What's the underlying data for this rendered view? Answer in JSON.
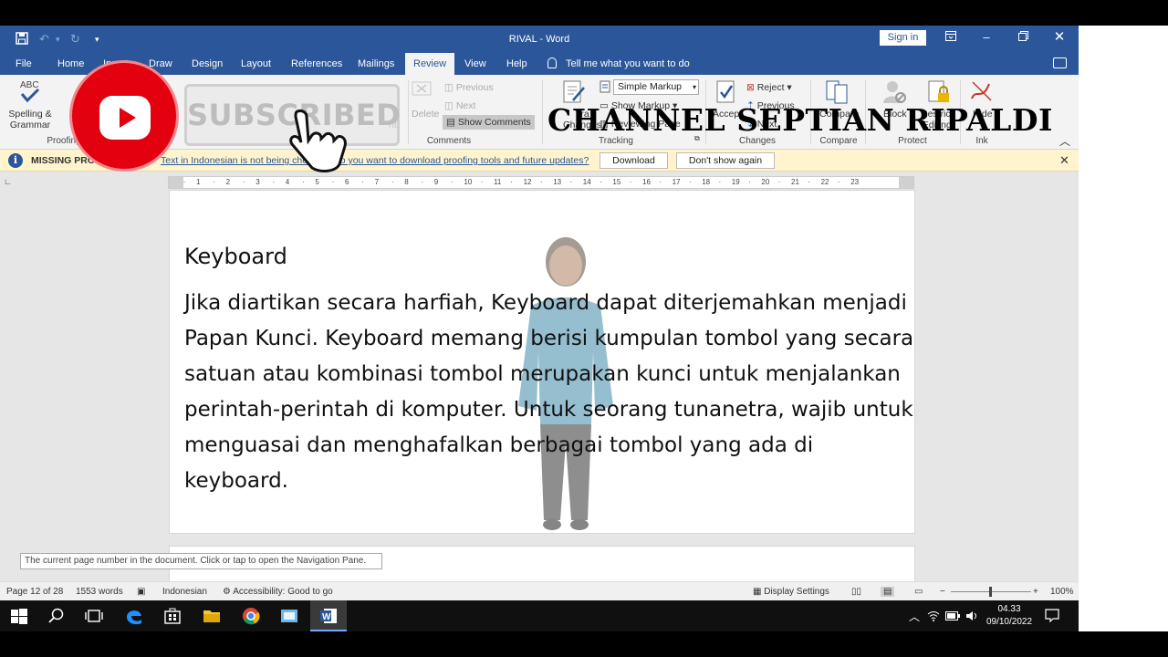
{
  "window": {
    "title": "RIVAL  -  Word",
    "signin_label": "Sign in"
  },
  "tabs": [
    "File",
    "Home",
    "Insert",
    "Draw",
    "Design",
    "Layout",
    "References",
    "Mailings",
    "Review",
    "View",
    "Help"
  ],
  "active_tab": "Review",
  "tell_me": "Tell me what you want to do",
  "ribbon": {
    "spelling_line1": "Spelling &",
    "spelling_line2": "Grammar",
    "proofing_label": "Proofing",
    "comments": {
      "delete": "Delete",
      "previous": "Previous",
      "next": "Next",
      "show_comments": "Show Comments",
      "new_comment": "nt",
      "group_label": "Comments"
    },
    "tracking": {
      "track_changes_line1": "Tra",
      "track_changes_line2": "Changes",
      "markup_select": "Simple Markup",
      "show_markup": "Show Markup",
      "reviewing_pane": "Reviewing Pane",
      "group_label": "Tracking"
    },
    "changes": {
      "accept": "Accept",
      "reject": "Reject",
      "previous": "Previous",
      "next": "Next",
      "group_label": "Changes"
    },
    "compare": {
      "compare": "Compare",
      "group_label": "Compare"
    },
    "protect": {
      "block_authors": "Block",
      "restrict_editing_line1": "Restrict",
      "restrict_editing_line2": "Editing",
      "group_label": "Protect"
    },
    "ink": {
      "hide_ink": "Hide",
      "group_label": "Ink"
    }
  },
  "message_bar": {
    "title": "MISSING PRO",
    "text": "Text in Indonesian is not being checked. Do you want to download proofing tools and future updates?",
    "download_button": "Download",
    "dont_show_button": "Don't show again"
  },
  "ruler_numbers": [
    "1",
    "2",
    "3",
    "4",
    "5",
    "6",
    "7",
    "8",
    "9",
    "10",
    "11",
    "12",
    "13",
    "14",
    "15",
    "16",
    "17",
    "18",
    "19",
    "20",
    "21",
    "22",
    "23"
  ],
  "document": {
    "heading": "Keyboard",
    "paragraph_lines": [
      "Jika diartikan secara harfiah, Keyboard dapat diterjemahkan menjadi",
      "Papan Kunci. Keyboard memang berisi kumpulan tombol yang secara",
      "satuan atau kombinasi tombol merupakan kunci untuk menjalankan",
      "perintah-perintah di komputer. Untuk seorang tunanetra, wajib untuk",
      "menguasai dan menghafalkan berbagai tombol yang ada di keyboard."
    ]
  },
  "tooltip": "The current page number in the document. Click or tap to open the Navigation Pane.",
  "status_bar": {
    "page": "Page 12 of 28",
    "words": "1553 words",
    "language": "Indonesian",
    "accessibility": "Accessibility: Good to go",
    "display_settings": "Display Settings",
    "zoom": "100%"
  },
  "overlays": {
    "subscribed": "SUBSCRIBED",
    "channel_name": "CHANNEL SEPTIAN RIPALDI"
  },
  "taskbar": {
    "time": "04.33",
    "date": "09/10/2022"
  }
}
